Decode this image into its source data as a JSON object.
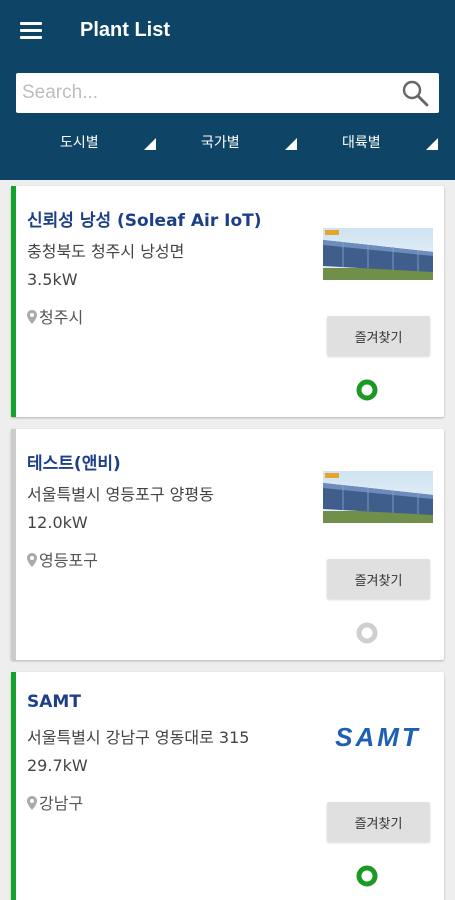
{
  "app": {
    "title": "Plant List"
  },
  "search": {
    "placeholder": "Search..."
  },
  "filters": [
    {
      "label": "도시별"
    },
    {
      "label": "국가별"
    },
    {
      "label": "대륙별"
    }
  ],
  "plants": [
    {
      "name": "신뢰성 낭성 (Soleaf Air IoT)",
      "address": "충청북도 청주시 낭성면",
      "capacity": "3.5kW",
      "location": "청주시",
      "button_label": "즐겨찾기",
      "status": "online",
      "accent_color": "#16a02c"
    },
    {
      "name": "테스트(앤비)",
      "address": "서울특별시 영등포구 양평동",
      "capacity": "12.0kW",
      "location": "영등포구",
      "button_label": "즐겨찾기",
      "status": "offline",
      "accent_color": "#cccccc"
    },
    {
      "name": "SAMT",
      "address": "서울특별시 강남구 영동대로 315",
      "capacity": "29.7kW",
      "location": "강남구",
      "button_label": "즐겨찾기",
      "status": "online",
      "accent_color": "#16a02c",
      "logo_text": "SAMT"
    }
  ],
  "colors": {
    "header": "#0e4466",
    "online": "#1a9a23",
    "offline": "#cfcfcf",
    "name_text": "#1d3f8a"
  }
}
